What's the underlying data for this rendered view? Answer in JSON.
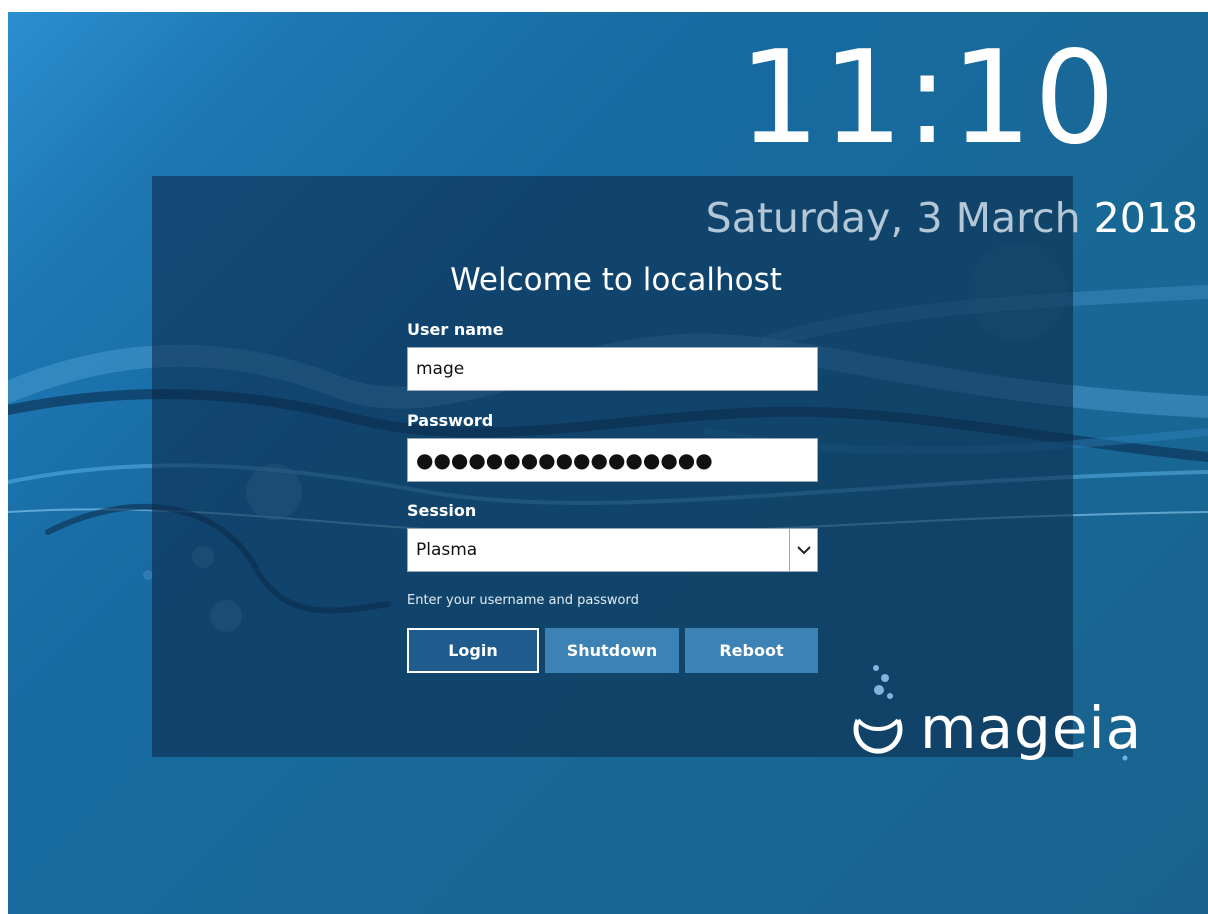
{
  "clock": {
    "time": "11:10",
    "date": "Saturday, 3 March",
    "year": "2018"
  },
  "greeting": "Welcome to localhost",
  "form": {
    "username": {
      "label": "User name",
      "value": "mage"
    },
    "password": {
      "label": "Password",
      "value": "●●●●●●●●●●●●●●●●●"
    },
    "session": {
      "label": "Session",
      "value": "Plasma"
    },
    "hint": "Enter your username and password"
  },
  "buttons": {
    "login": "Login",
    "shutdown": "Shutdown",
    "reboot": "Reboot"
  },
  "logo": {
    "text": "mageia"
  },
  "colors": {
    "background": "#176aa2",
    "panel": "#0c2a48",
    "button": "#3d82b5",
    "button_primary": "#1f5b8d"
  }
}
